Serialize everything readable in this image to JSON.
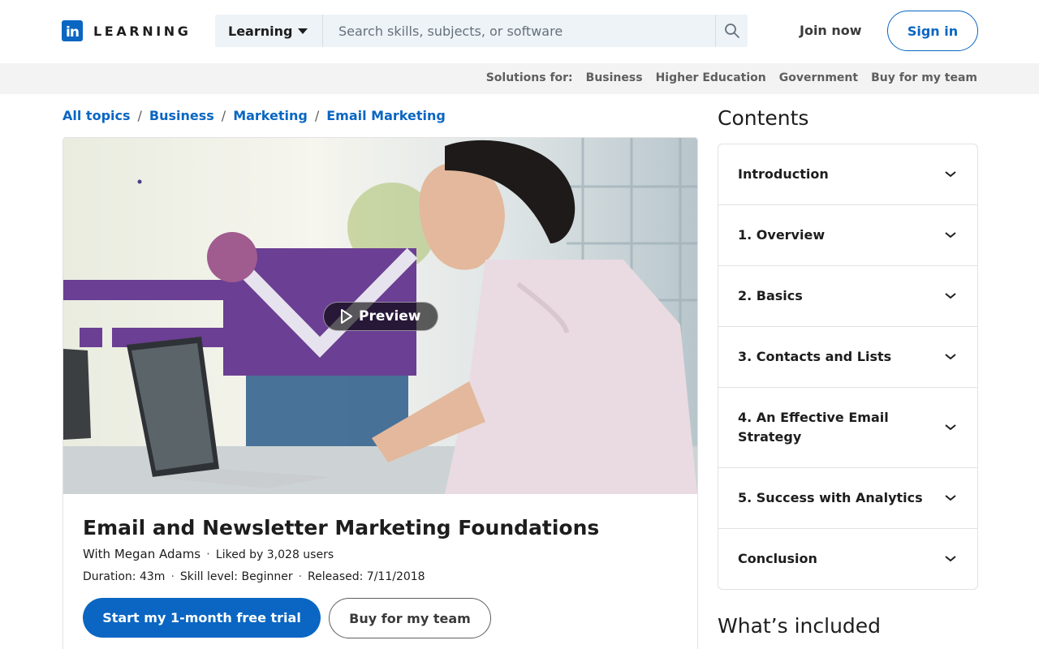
{
  "header": {
    "logo_mark": "in",
    "logo_text": "LEARNING",
    "search_category": "Learning",
    "search_placeholder": "Search skills, subjects, or software",
    "join_label": "Join now",
    "signin_label": "Sign in"
  },
  "subnav": {
    "label": "Solutions for:",
    "links": [
      "Business",
      "Higher Education",
      "Government",
      "Buy for my team"
    ]
  },
  "breadcrumb": [
    "All topics",
    "Business",
    "Marketing",
    "Email Marketing"
  ],
  "course": {
    "preview_label": "Preview",
    "title": "Email and Newsletter Marketing Foundations",
    "instructor": "With Megan Adams",
    "likes": "Liked by 3,028 users",
    "duration": "Duration: 43m",
    "skill": "Skill level: Beginner",
    "released": "Released: 7/11/2018",
    "trial_label": "Start my 1-month free trial",
    "team_label": "Buy for my team"
  },
  "contents": {
    "title": "Contents",
    "items": [
      "Introduction",
      "1. Overview",
      "2. Basics",
      "3. Contacts and Lists",
      "4. An Effective Email Strategy",
      "5. Success with Analytics",
      "Conclusion"
    ]
  },
  "included_title": "What’s included",
  "colors": {
    "brand": "#0a66c2",
    "envelope": "#6b3f93"
  },
  "icons": {
    "search": "search-icon",
    "play": "play-icon",
    "chevron": "chevron-down-icon",
    "caret": "caret-down-icon"
  }
}
